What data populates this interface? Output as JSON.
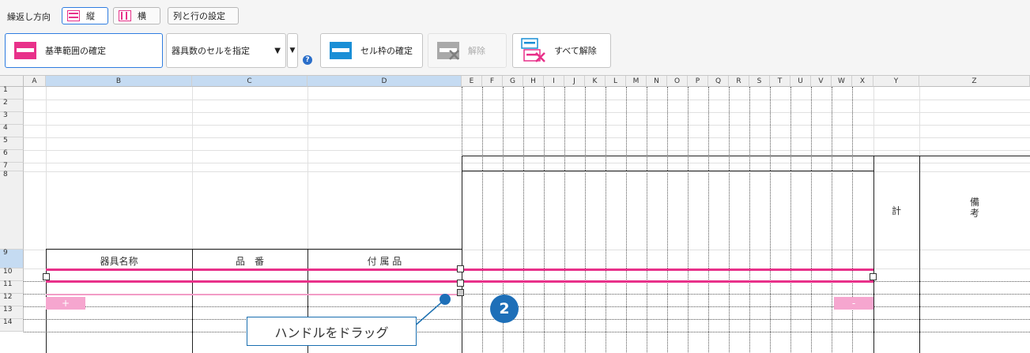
{
  "toolbar": {
    "repeat_direction_label": "繰返し方向",
    "vertical_label": "縦",
    "horizontal_label": "横",
    "colrow_settings_label": "列と行の設定",
    "base_range_label": "基準範囲の確定",
    "fixture_select_value": "器具数のセルを指定",
    "cell_frame_label": "セル枠の確定",
    "release_label": "解除",
    "release_all_label": "すべて解除"
  },
  "sheet": {
    "columns": [
      "A",
      "B",
      "C",
      "D",
      "E",
      "F",
      "G",
      "H",
      "I",
      "J",
      "K",
      "L",
      "M",
      "N",
      "O",
      "P",
      "Q",
      "R",
      "S",
      "T",
      "U",
      "V",
      "W",
      "X",
      "Y",
      "Z"
    ],
    "rows": [
      "1",
      "2",
      "3",
      "4",
      "5",
      "6",
      "7",
      "8",
      "9",
      "10",
      "11",
      "12",
      "13",
      "14"
    ],
    "cells": {
      "fixture_name": "器具名称",
      "part_number": "品　番",
      "accessory": "付 属 品",
      "total": "計",
      "remarks_line1": "備",
      "remarks_line2": "考",
      "plus": "+",
      "minus": "-"
    }
  },
  "annotation": {
    "callout_text": "ハンドルをドラッグ",
    "step_number": "2"
  },
  "colors": {
    "accent": "#e8318a",
    "selection": "#2f7de1",
    "badge": "#1e6fb8"
  }
}
